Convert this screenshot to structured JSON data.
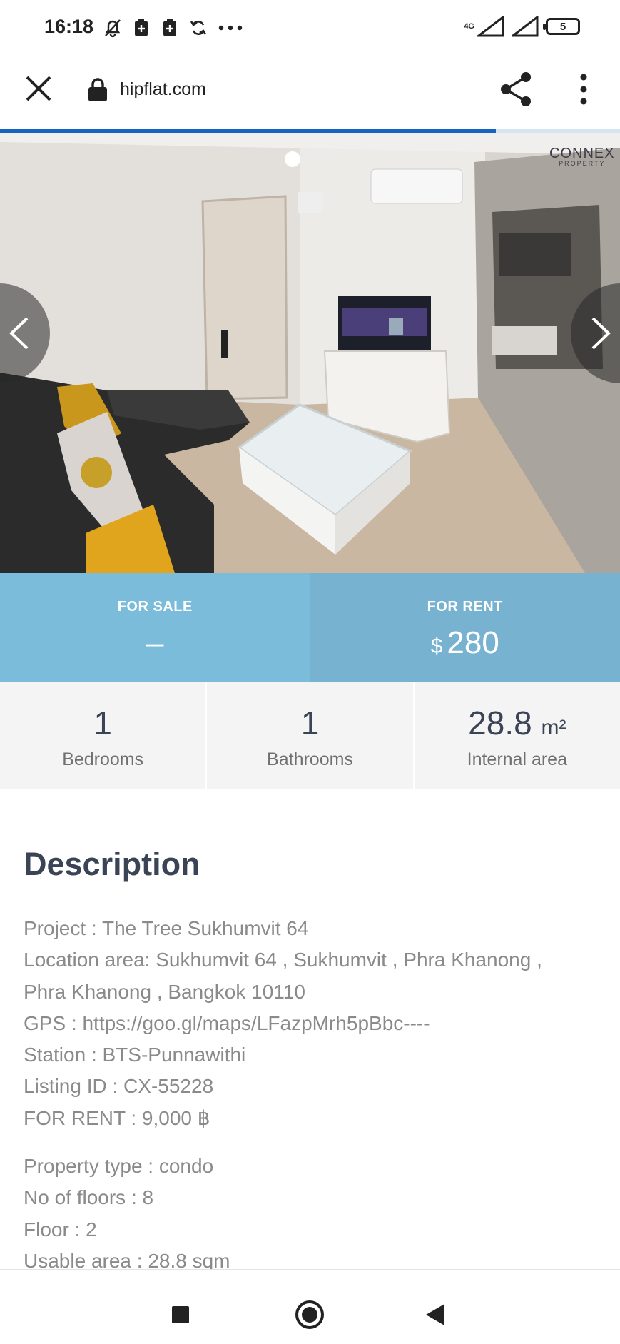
{
  "status_bar": {
    "time": "16:18",
    "icons": [
      "mute-bell-icon",
      "battery-plus-icon",
      "battery-plus-icon",
      "sync-icon",
      "more-dots-icon"
    ],
    "network": "4G",
    "battery_level": "5"
  },
  "browser": {
    "url": "hipflat.com",
    "load_progress": 0.8
  },
  "photo": {
    "watermark_brand": "CONNEX",
    "watermark_sub": "PROPERTY"
  },
  "price": {
    "sale_label": "FOR SALE",
    "sale_value": "–",
    "rent_label": "FOR RENT",
    "rent_currency": "$",
    "rent_value": "280"
  },
  "stats": {
    "bedrooms_value": "1",
    "bedrooms_label": "Bedrooms",
    "bathrooms_value": "1",
    "bathrooms_label": "Bathrooms",
    "area_value": "28.8",
    "area_unit": "m²",
    "area_label": "Internal area"
  },
  "description": {
    "title": "Description",
    "block1": [
      "Project : The Tree Sukhumvit 64",
      "Location area: Sukhumvit 64 , Sukhumvit , Phra Khanong ,",
      "Phra Khanong , Bangkok 10110",
      "GPS : https://goo.gl/maps/LFazpMrh5pBbc----",
      "Station : BTS-Punnawithi",
      "Listing ID : CX-55228",
      "FOR RENT : 9,000 ฿"
    ],
    "block2": [
      "Property type : condo",
      "No of floors : 8",
      "Floor : 2",
      "Usable area : 28.8 sqm"
    ]
  },
  "colors": {
    "sale_bg": "#7bbcdb",
    "rent_bg": "#77b2d0",
    "progress": "#1565c0",
    "heading": "#3b4456"
  }
}
